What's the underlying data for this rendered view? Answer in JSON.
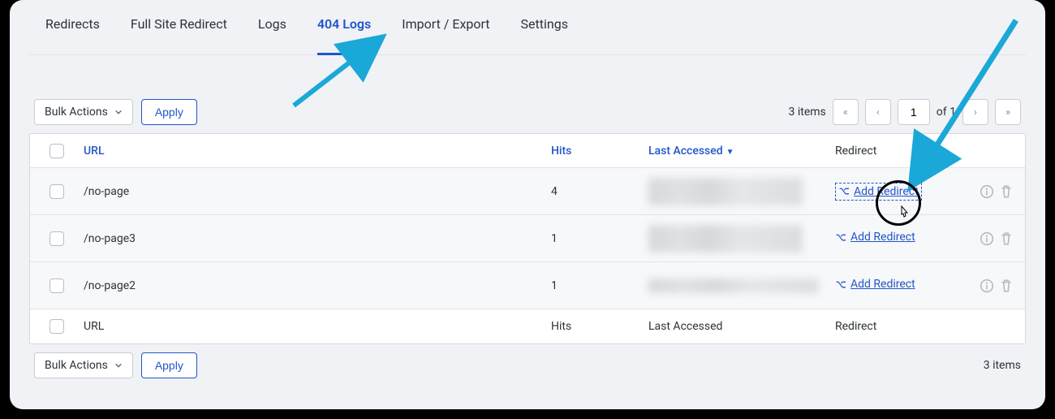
{
  "tabs": {
    "redirects": "Redirects",
    "full_site": "Full Site Redirect",
    "logs": "Logs",
    "logs404": "404 Logs",
    "import_export": "Import / Export",
    "settings": "Settings"
  },
  "toolbar": {
    "bulk_label": "Bulk Actions",
    "apply": "Apply",
    "items_count": "3 items",
    "page_current": "1",
    "page_of": "of 1"
  },
  "columns": {
    "url": "URL",
    "hits": "Hits",
    "last_accessed": "Last Accessed",
    "redirect": "Redirect"
  },
  "rows": [
    {
      "url": "/no-page",
      "hits": "4",
      "add_label": "Add Redirect"
    },
    {
      "url": "/no-page3",
      "hits": "1",
      "add_label": "Add Redirect"
    },
    {
      "url": "/no-page2",
      "hits": "1",
      "add_label": "Add Redirect"
    }
  ],
  "footer": {
    "items_count": "3 items"
  }
}
